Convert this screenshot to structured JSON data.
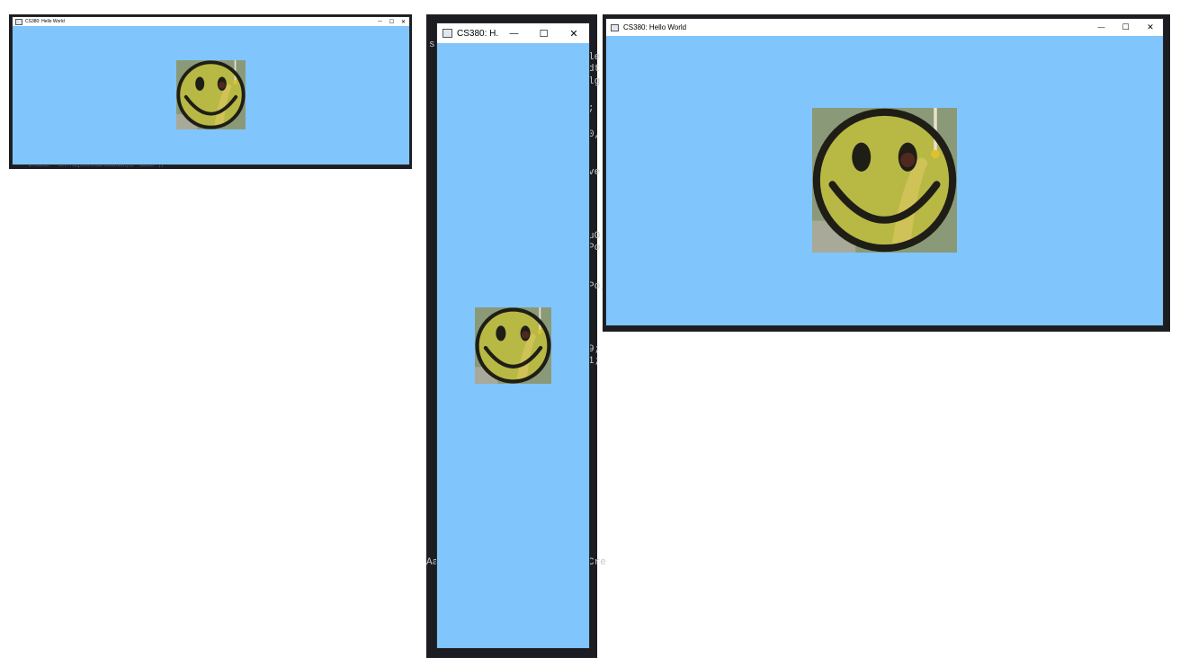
{
  "windows": [
    {
      "title": "CS380: Hello World",
      "controls": {
        "minimize_label": "—",
        "maximize_label": "☐",
        "close_label": "✕"
      }
    },
    {
      "title": "CS380: H...",
      "controls": {
        "minimize_label": "—",
        "maximize_label": "☐",
        "close_label": "✕"
      }
    },
    {
      "title": "CS380: Hello World",
      "controls": {
        "minimize_label": "—",
        "maximize_label": "☐",
        "close_label": "✕"
      }
    }
  ],
  "sprite": {
    "description_icon": "smiley-face-squirrel-icon"
  },
  "background_editor": {
    "bottom_snippet": "a.scaler = self.objectAtAddrLocation(o, 'scaler');",
    "middle_left_fragments": [
      "sl",
      "le",
      "dt",
      "lg",
      ";",
      "0,",
      "ve",
      "s",
      "uO",
      "Po",
      "Po;",
      "9;",
      "1;",
      "Aas"
    ],
    "right_fragments": [
      "Cre"
    ]
  },
  "colors": {
    "client_background": "#81c5fd",
    "editor_background": "#1b1d22",
    "smiley_yellow": "#b8b845",
    "smiley_outline": "#1e1e16"
  }
}
